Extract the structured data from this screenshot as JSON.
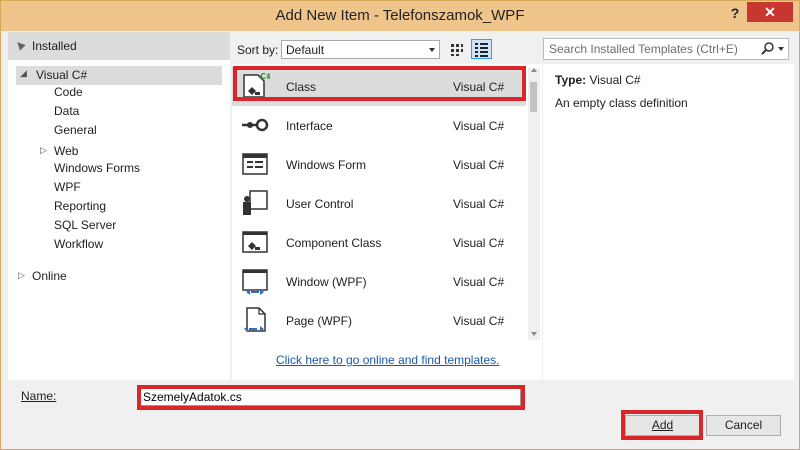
{
  "window": {
    "title": "Add New Item - Telefonszamok_WPF",
    "help_label": "?",
    "close_label": "✕"
  },
  "tree": {
    "installed": "Installed",
    "visual_csharp": "Visual C#",
    "children": [
      "Code",
      "Data",
      "General",
      "Web",
      "Windows Forms",
      "WPF",
      "Reporting",
      "SQL Server",
      "Workflow"
    ],
    "online": "Online"
  },
  "toolbar": {
    "sort_label": "Sort by:",
    "sort_value": "Default"
  },
  "search": {
    "placeholder": "Search Installed Templates (Ctrl+E)"
  },
  "templates": [
    {
      "name": "Class",
      "lang": "Visual C#",
      "icon": "class-icon"
    },
    {
      "name": "Interface",
      "lang": "Visual C#",
      "icon": "interface-icon"
    },
    {
      "name": "Windows Form",
      "lang": "Visual C#",
      "icon": "windows-form-icon"
    },
    {
      "name": "User Control",
      "lang": "Visual C#",
      "icon": "user-control-icon"
    },
    {
      "name": "Component Class",
      "lang": "Visual C#",
      "icon": "component-class-icon"
    },
    {
      "name": "Window (WPF)",
      "lang": "Visual C#",
      "icon": "window-wpf-icon"
    },
    {
      "name": "Page (WPF)",
      "lang": "Visual C#",
      "icon": "page-wpf-icon"
    }
  ],
  "online_link": "Click here to go online and find templates.",
  "description": {
    "type_label": "Type:",
    "type_value": "Visual C#",
    "text": "An empty class definition"
  },
  "name_field": {
    "label": "Name:",
    "value": "SzemelyAdatok.cs"
  },
  "buttons": {
    "add": "Add",
    "cancel": "Cancel"
  },
  "colors": {
    "title_bar": "#f0c58c",
    "close_button": "#c7372f",
    "highlight": "#d9262b",
    "link": "#1a58a8",
    "selection": "#dcdcdc"
  }
}
